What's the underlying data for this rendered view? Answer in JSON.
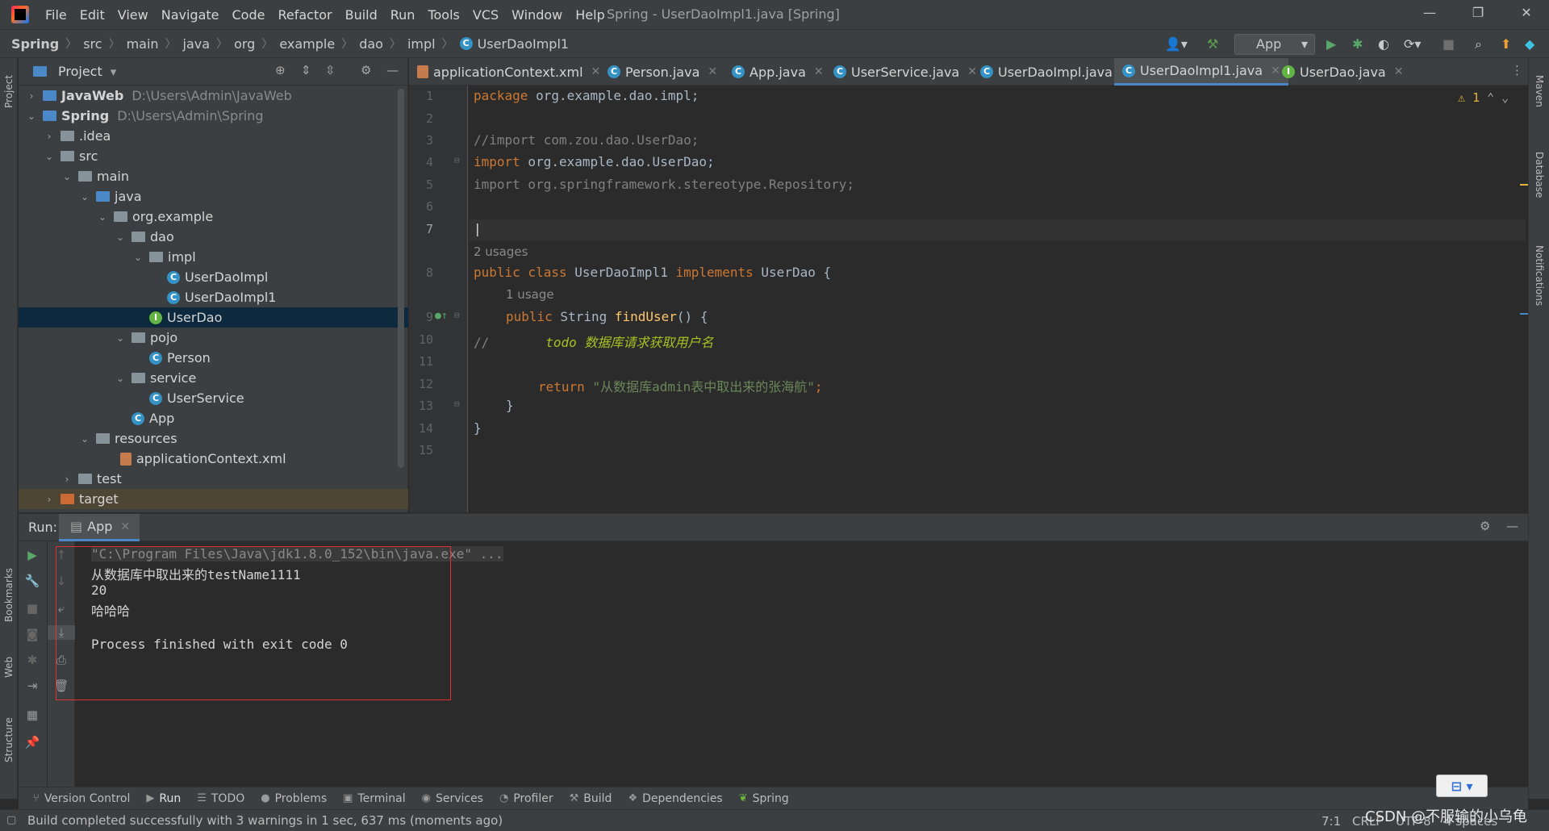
{
  "menu": {
    "items": [
      "File",
      "Edit",
      "View",
      "Navigate",
      "Code",
      "Refactor",
      "Build",
      "Run",
      "Tools",
      "VCS",
      "Window",
      "Help"
    ],
    "window_title": "Spring - UserDaoImpl1.java [Spring]"
  },
  "breadcrumb": [
    "Spring",
    "src",
    "main",
    "java",
    "org",
    "example",
    "dao",
    "impl",
    "UserDaoImpl1"
  ],
  "toolbar": {
    "run_config": "App"
  },
  "project_panel": {
    "title": "Project",
    "tree": [
      {
        "label": "JavaWeb",
        "hint": "D:\\Users\\Admin\\JavaWeb"
      },
      {
        "label": "Spring",
        "hint": "D:\\Users\\Admin\\Spring"
      },
      {
        "label": ".idea"
      },
      {
        "label": "src"
      },
      {
        "label": "main"
      },
      {
        "label": "java"
      },
      {
        "label": "org.example"
      },
      {
        "label": "dao"
      },
      {
        "label": "impl"
      },
      {
        "label": "UserDaoImpl"
      },
      {
        "label": "UserDaoImpl1"
      },
      {
        "label": "UserDao"
      },
      {
        "label": "pojo"
      },
      {
        "label": "Person"
      },
      {
        "label": "service"
      },
      {
        "label": "UserService"
      },
      {
        "label": "App"
      },
      {
        "label": "resources"
      },
      {
        "label": "applicationContext.xml"
      },
      {
        "label": "test"
      },
      {
        "label": "target"
      }
    ]
  },
  "tabs": [
    {
      "label": "applicationContext.xml"
    },
    {
      "label": "Person.java"
    },
    {
      "label": "App.java"
    },
    {
      "label": "UserService.java"
    },
    {
      "label": "UserDaoImpl.java"
    },
    {
      "label": "UserDaoImpl1.java"
    },
    {
      "label": "UserDao.java"
    }
  ],
  "editor": {
    "line_numbers": [
      "1",
      "2",
      "3",
      "4",
      "5",
      "6",
      "7",
      "8",
      "9",
      "10",
      "11",
      "12",
      "13",
      "14",
      "15"
    ],
    "warning_count": "1",
    "inlay_usages_class": "2 usages",
    "inlay_usages_method": "1 usage",
    "code": {
      "l1_kw": "package",
      "l1_rest": " org.example.dao.impl;",
      "l3": "//import com.zou.dao.UserDao;",
      "l4_kw": "import",
      "l4_rest": " org.example.dao.UserDao;",
      "l5": "import org.springframework.stereotype.Repository;",
      "l8_kw1": "public class",
      "l8_name": " UserDaoImpl1 ",
      "l8_kw2": "implements",
      "l8_rest": " UserDao {",
      "l9_kw": "public",
      "l9_type": " String ",
      "l9_fn": "findUser",
      "l9_rest": "() {",
      "l10_comment": "//",
      "l10_todo": "todo",
      "l10_todo_text": " 数据库请求获取用户名",
      "l12_kw": "return",
      "l12_str": " \"从数据库admin表中取出来的张海航\"",
      "l12_end": ";",
      "l13": "}",
      "l14": "}"
    }
  },
  "run_panel": {
    "label": "Run:",
    "tab": "App",
    "console": [
      "\"C:\\Program Files\\Java\\jdk1.8.0_152\\bin\\java.exe\" ...",
      "从数据库中取出来的testName1111",
      "20",
      "哈哈哈",
      "",
      "Process finished with exit code 0"
    ]
  },
  "tool_tabs": [
    "Version Control",
    "Run",
    "TODO",
    "Problems",
    "Terminal",
    "Services",
    "Profiler",
    "Build",
    "Dependencies",
    "Spring"
  ],
  "left_strip": [
    "Project",
    "Bookmarks",
    "Web",
    "Structure"
  ],
  "right_strip": [
    "Maven",
    "Database",
    "Notifications"
  ],
  "status": {
    "message": "Build completed successfully with 3 warnings in 1 sec, 637 ms (moments ago)",
    "position": "7:1",
    "line_sep": "CRLF",
    "encoding": "UTF-8",
    "indent": "4 spaces"
  },
  "watermark": "CSDN @不服输的小乌龟",
  "colors": {
    "accent": "#4a88c7",
    "highlight_box": "#e03131",
    "keyword": "#cc7832",
    "string": "#6a8759",
    "todo": "#a8c023"
  }
}
